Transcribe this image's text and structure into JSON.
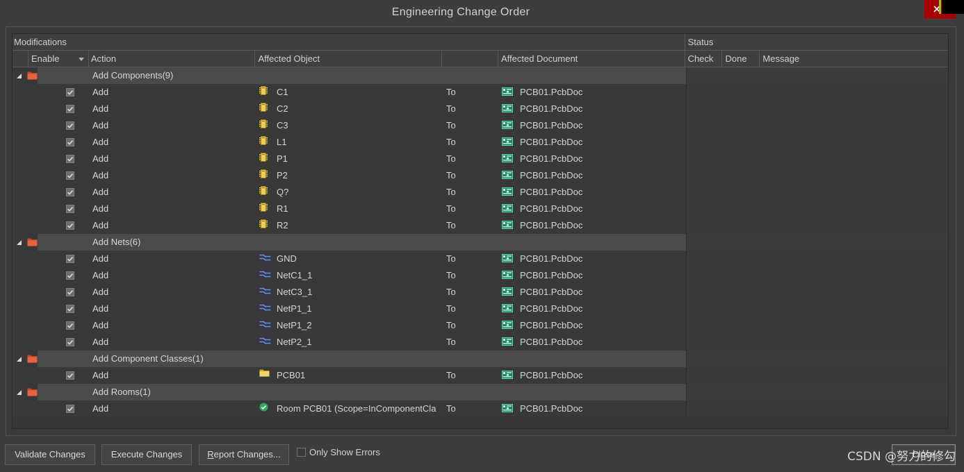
{
  "window": {
    "title": "Engineering Change Order"
  },
  "colors": {
    "close_button": "#a80000",
    "group_folder": "#e8643c",
    "component_icon": "#f2cd55",
    "net_icon": "#6b8dff",
    "class_folder": "#f3d766",
    "room_icon": "#2faa5c",
    "pcb_document_icon": "#1d8a62"
  },
  "table": {
    "header_groups": {
      "modifications": "Modifications",
      "status": "Status"
    },
    "columns": {
      "enable": "Enable",
      "action": "Action",
      "affected_object": "Affected Object",
      "affected_document": "Affected Document",
      "check": "Check",
      "done": "Done",
      "message": "Message"
    },
    "groups": [
      {
        "label": "Add Components(9)",
        "icon": "folder-icon",
        "expanded": true,
        "items": [
          {
            "enabled": true,
            "action": "Add",
            "object": "C1",
            "object_icon": "component-icon",
            "to": "To",
            "document": "PCB01.PcbDoc",
            "document_icon": "pcb-document-icon"
          },
          {
            "enabled": true,
            "action": "Add",
            "object": "C2",
            "object_icon": "component-icon",
            "to": "To",
            "document": "PCB01.PcbDoc",
            "document_icon": "pcb-document-icon"
          },
          {
            "enabled": true,
            "action": "Add",
            "object": "C3",
            "object_icon": "component-icon",
            "to": "To",
            "document": "PCB01.PcbDoc",
            "document_icon": "pcb-document-icon"
          },
          {
            "enabled": true,
            "action": "Add",
            "object": "L1",
            "object_icon": "component-icon",
            "to": "To",
            "document": "PCB01.PcbDoc",
            "document_icon": "pcb-document-icon"
          },
          {
            "enabled": true,
            "action": "Add",
            "object": "P1",
            "object_icon": "component-icon",
            "to": "To",
            "document": "PCB01.PcbDoc",
            "document_icon": "pcb-document-icon"
          },
          {
            "enabled": true,
            "action": "Add",
            "object": "P2",
            "object_icon": "component-icon",
            "to": "To",
            "document": "PCB01.PcbDoc",
            "document_icon": "pcb-document-icon"
          },
          {
            "enabled": true,
            "action": "Add",
            "object": "Q?",
            "object_icon": "component-icon",
            "to": "To",
            "document": "PCB01.PcbDoc",
            "document_icon": "pcb-document-icon"
          },
          {
            "enabled": true,
            "action": "Add",
            "object": "R1",
            "object_icon": "component-icon",
            "to": "To",
            "document": "PCB01.PcbDoc",
            "document_icon": "pcb-document-icon"
          },
          {
            "enabled": true,
            "action": "Add",
            "object": "R2",
            "object_icon": "component-icon",
            "to": "To",
            "document": "PCB01.PcbDoc",
            "document_icon": "pcb-document-icon"
          }
        ]
      },
      {
        "label": "Add Nets(6)",
        "icon": "folder-icon",
        "expanded": true,
        "items": [
          {
            "enabled": true,
            "action": "Add",
            "object": "GND",
            "object_icon": "net-icon",
            "to": "To",
            "document": "PCB01.PcbDoc",
            "document_icon": "pcb-document-icon"
          },
          {
            "enabled": true,
            "action": "Add",
            "object": "NetC1_1",
            "object_icon": "net-icon",
            "to": "To",
            "document": "PCB01.PcbDoc",
            "document_icon": "pcb-document-icon"
          },
          {
            "enabled": true,
            "action": "Add",
            "object": "NetC3_1",
            "object_icon": "net-icon",
            "to": "To",
            "document": "PCB01.PcbDoc",
            "document_icon": "pcb-document-icon"
          },
          {
            "enabled": true,
            "action": "Add",
            "object": "NetP1_1",
            "object_icon": "net-icon",
            "to": "To",
            "document": "PCB01.PcbDoc",
            "document_icon": "pcb-document-icon"
          },
          {
            "enabled": true,
            "action": "Add",
            "object": "NetP1_2",
            "object_icon": "net-icon",
            "to": "To",
            "document": "PCB01.PcbDoc",
            "document_icon": "pcb-document-icon"
          },
          {
            "enabled": true,
            "action": "Add",
            "object": "NetP2_1",
            "object_icon": "net-icon",
            "to": "To",
            "document": "PCB01.PcbDoc",
            "document_icon": "pcb-document-icon"
          }
        ]
      },
      {
        "label": "Add Component Classes(1)",
        "icon": "folder-icon",
        "expanded": true,
        "items": [
          {
            "enabled": true,
            "action": "Add",
            "object": "PCB01",
            "object_icon": "component-class-icon",
            "to": "To",
            "document": "PCB01.PcbDoc",
            "document_icon": "pcb-document-icon"
          }
        ]
      },
      {
        "label": "Add Rooms(1)",
        "icon": "folder-icon",
        "expanded": true,
        "items": [
          {
            "enabled": true,
            "action": "Add",
            "object": "Room PCB01 (Scope=InComponentCla",
            "object_icon": "room-icon",
            "to": "To",
            "document": "PCB01.PcbDoc",
            "document_icon": "pcb-document-icon"
          }
        ]
      }
    ]
  },
  "footer": {
    "validate_label": "Validate Changes",
    "execute_label": "Execute Changes",
    "report_label": "Report Changes...",
    "only_show_errors": {
      "label": "Only Show Errors",
      "checked": false
    },
    "close_label": "Close"
  },
  "watermark": "CSDN @努力的修勾"
}
